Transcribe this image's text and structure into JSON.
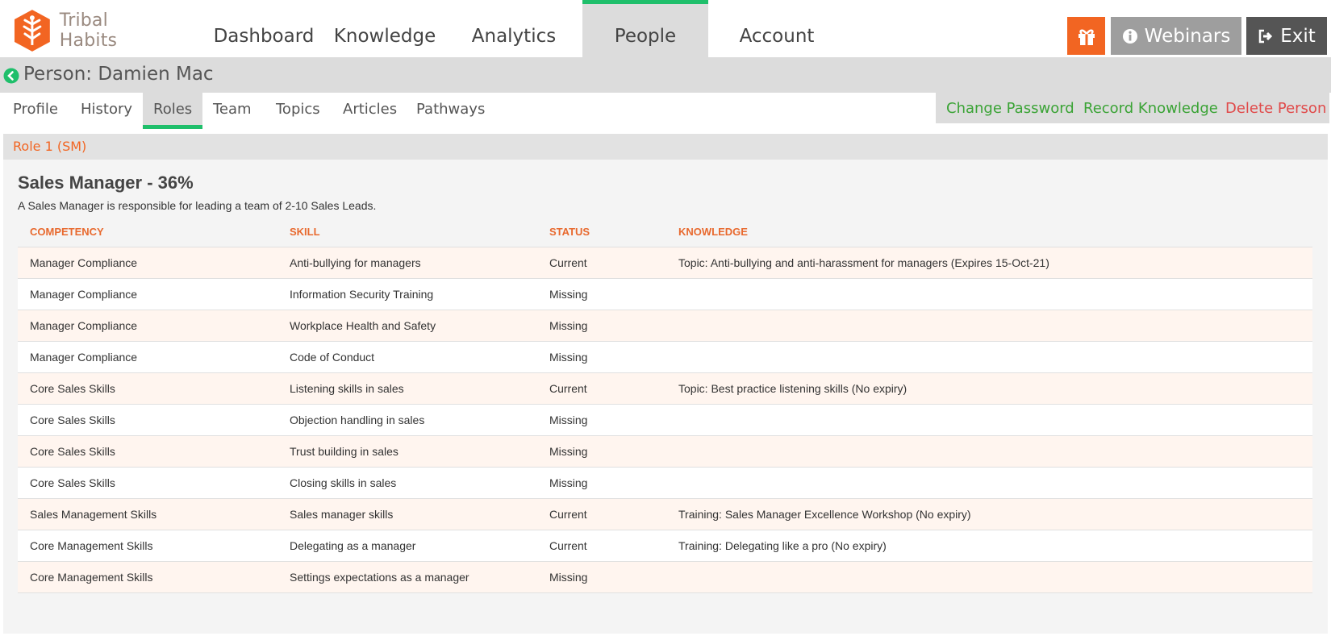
{
  "brand": {
    "name": "Tribal Habits",
    "color": "#f26522"
  },
  "nav": {
    "items": [
      "Dashboard",
      "Knowledge",
      "Analytics",
      "People",
      "Account"
    ],
    "active": "People"
  },
  "header_buttons": {
    "gift_icon": "gift-icon",
    "webinars": "Webinars",
    "exit": "Exit"
  },
  "person": {
    "title": "Person: Damien Mac"
  },
  "subtabs": {
    "items": [
      "Profile",
      "History",
      "Roles",
      "Team",
      "Topics",
      "Articles",
      "Pathways"
    ],
    "active": "Roles"
  },
  "actions": {
    "change_password": "Change Password",
    "record_knowledge": "Record Knowledge",
    "delete_person": "Delete Person"
  },
  "role": {
    "label": "Role 1 (SM)",
    "title": "Sales Manager - 36%",
    "description": "A Sales Manager is responsible for leading a team of 2-10 Sales Leads."
  },
  "table": {
    "columns": [
      "COMPETENCY",
      "SKILL",
      "STATUS",
      "KNOWLEDGE"
    ],
    "rows": [
      [
        "Manager Compliance",
        "Anti-bullying for managers",
        "Current",
        "Topic: Anti-bullying and anti-harassment for managers (Expires 15-Oct-21)"
      ],
      [
        "Manager Compliance",
        "Information Security Training",
        "Missing",
        ""
      ],
      [
        "Manager Compliance",
        "Workplace Health and Safety",
        "Missing",
        ""
      ],
      [
        "Manager Compliance",
        "Code of Conduct",
        "Missing",
        ""
      ],
      [
        "Core Sales Skills",
        "Listening skills in sales",
        "Current",
        "Topic: Best practice listening skills (No expiry)"
      ],
      [
        "Core Sales Skills",
        "Objection handling in sales",
        "Missing",
        ""
      ],
      [
        "Core Sales Skills",
        "Trust building in sales",
        "Missing",
        ""
      ],
      [
        "Core Sales Skills",
        "Closing skills in sales",
        "Missing",
        ""
      ],
      [
        "Sales Management Skills",
        "Sales manager skills",
        "Current",
        "Training: Sales Manager Excellence Workshop (No expiry)"
      ],
      [
        "Core Management Skills",
        "Delegating as a manager",
        "Current",
        "Training: Delegating like a pro (No expiry)"
      ],
      [
        "Core Management Skills",
        "Settings expectations as a manager",
        "Missing",
        ""
      ]
    ]
  },
  "colors": {
    "accent_green": "#1fbf6b",
    "action_green": "#3aa335",
    "danger_red": "#e04a4a",
    "header_orange": "#e8692e"
  }
}
